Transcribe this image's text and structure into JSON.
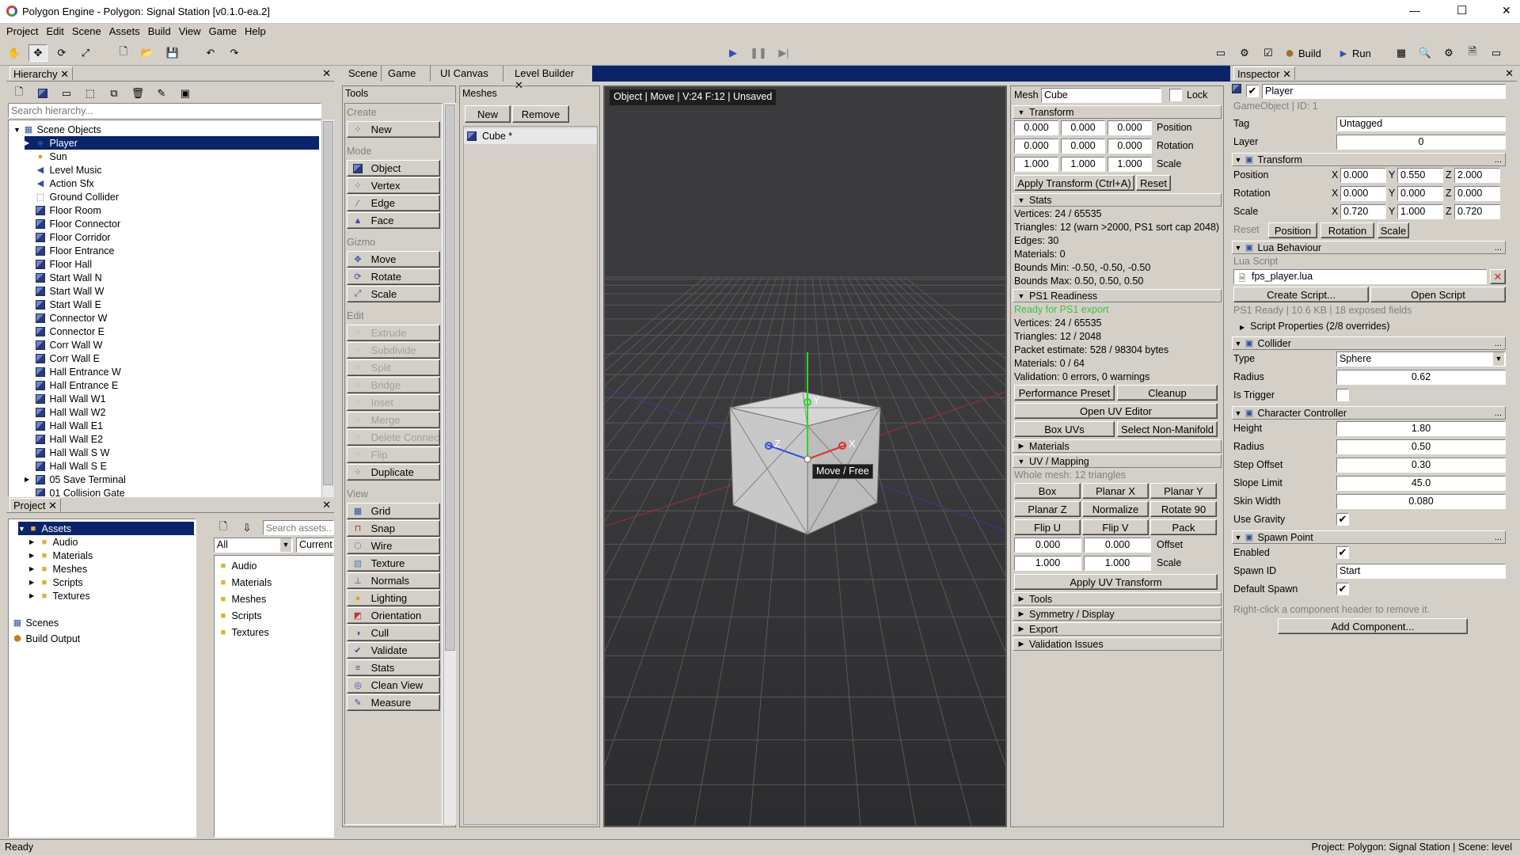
{
  "window": {
    "title": "Polygon Engine - Polygon: Signal Station [v0.1.0-ea.2]",
    "min": "—",
    "max": "☐",
    "close": "✕"
  },
  "menu": [
    "Project",
    "Edit",
    "Scene",
    "Assets",
    "Build",
    "View",
    "Game",
    "Help"
  ],
  "toolbar": {
    "build_label": "Build",
    "run_label": "Run"
  },
  "hierarchy": {
    "tab": "Hierarchy",
    "search_placeholder": "Search hierarchy...",
    "root": "Scene Objects",
    "items": [
      {
        "label": "Player",
        "icon": "player-icon",
        "selected": true
      },
      {
        "label": "Sun",
        "icon": "bulb-icon"
      },
      {
        "label": "Level Music",
        "icon": "speaker-icon"
      },
      {
        "label": "Action Sfx",
        "icon": "speaker-icon"
      },
      {
        "label": "Ground Collider",
        "icon": "collider-icon"
      },
      {
        "label": "Floor Room",
        "icon": "cube-icon"
      },
      {
        "label": "Floor Connector",
        "icon": "cube-icon"
      },
      {
        "label": "Floor Corridor",
        "icon": "cube-icon"
      },
      {
        "label": "Floor Entrance",
        "icon": "cube-icon"
      },
      {
        "label": "Floor Hall",
        "icon": "cube-icon"
      },
      {
        "label": "Start Wall N",
        "icon": "cube-icon"
      },
      {
        "label": "Start Wall W",
        "icon": "cube-icon"
      },
      {
        "label": "Start Wall E",
        "icon": "cube-icon"
      },
      {
        "label": "Connector W",
        "icon": "cube-icon"
      },
      {
        "label": "Connector E",
        "icon": "cube-icon"
      },
      {
        "label": "Corr Wall W",
        "icon": "cube-icon"
      },
      {
        "label": "Corr Wall E",
        "icon": "cube-icon"
      },
      {
        "label": "Hall Entrance W",
        "icon": "cube-icon"
      },
      {
        "label": "Hall Entrance E",
        "icon": "cube-icon"
      },
      {
        "label": "Hall Wall W1",
        "icon": "cube-icon"
      },
      {
        "label": "Hall Wall W2",
        "icon": "cube-icon"
      },
      {
        "label": "Hall Wall E1",
        "icon": "cube-icon"
      },
      {
        "label": "Hall Wall E2",
        "icon": "cube-icon"
      },
      {
        "label": "Hall Wall S W",
        "icon": "cube-icon"
      },
      {
        "label": "Hall Wall S E",
        "icon": "cube-icon"
      },
      {
        "label": "05 Save Terminal",
        "icon": "cube-icon",
        "expander": true
      },
      {
        "label": "01 Collision Gate",
        "icon": "cube-icon"
      }
    ]
  },
  "project": {
    "tab": "Project",
    "search_placeholder": "Search assets...",
    "filter": "All",
    "scope": "Current",
    "tree": {
      "assets": "Assets",
      "children": [
        "Audio",
        "Materials",
        "Meshes",
        "Scripts",
        "Textures"
      ],
      "scenes": "Scenes",
      "build_output": "Build Output"
    },
    "folders": [
      "Audio",
      "Materials",
      "Meshes",
      "Scripts",
      "Textures"
    ]
  },
  "tabs": [
    "Scene",
    "Game",
    "UI Canvas",
    "Level Builder"
  ],
  "tools": {
    "title": "Tools",
    "create_header": "Create",
    "new": "New",
    "mode_header": "Mode",
    "modes": [
      "Object",
      "Vertex",
      "Edge",
      "Face"
    ],
    "gizmo_header": "Gizmo",
    "gizmos": [
      "Move",
      "Rotate",
      "Scale"
    ],
    "edit_header": "Edit",
    "edits": [
      "Extrude",
      "Subdivide",
      "Split",
      "Bridge",
      "Inset",
      "Merge",
      "Delete Connected",
      "Flip",
      "Duplicate"
    ],
    "view_header": "View",
    "views": [
      "Grid",
      "Snap",
      "Wire",
      "Texture",
      "Normals",
      "Lighting",
      "Orientation",
      "Cull",
      "Validate",
      "Stats",
      "Clean View",
      "Measure"
    ]
  },
  "meshes": {
    "title": "Meshes",
    "new": "New",
    "remove": "Remove",
    "items": [
      "Cube *"
    ]
  },
  "viewport": {
    "status": "Object | Move | V:24 F:12 | Unsaved",
    "tooltip": "Move / Free",
    "axis_x": "X",
    "axis_y": "Y",
    "axis_z": "Z"
  },
  "meshpanel": {
    "mesh_label": "Mesh",
    "mesh_name": "Cube",
    "lock": "Lock",
    "transform_header": "Transform",
    "position": [
      "0.000",
      "0.000",
      "0.000"
    ],
    "rotation": [
      "0.000",
      "0.000",
      "0.000"
    ],
    "scale": [
      "1.000",
      "1.000",
      "1.000"
    ],
    "position_label": "Position",
    "rotation_label": "Rotation",
    "scale_label": "Scale",
    "apply_transform": "Apply Transform (Ctrl+A)",
    "reset": "Reset",
    "stats_header": "Stats",
    "stats": [
      "Vertices: 24 / 65535",
      "Triangles: 12 (warn >2000, PS1 sort cap 2048)",
      "Edges: 30",
      "Materials: 0",
      "Bounds Min: -0.50, -0.50, -0.50",
      "Bounds Max: 0.50, 0.50, 0.50"
    ],
    "ps1_header": "PS1 Readiness",
    "ps1_ready": "Ready for PS1 export",
    "ps1": [
      "Vertices: 24 / 65535",
      "Triangles: 12 / 2048",
      "Packet estimate: 528 / 98304 bytes",
      "Materials: 0 / 64",
      "Validation: 0 errors, 0 warnings"
    ],
    "performance_preset": "Performance Preset",
    "cleanup": "Cleanup",
    "open_uv_editor": "Open UV Editor",
    "box_uvs": "Box UVs",
    "select_non_manifold": "Select Non-Manifold",
    "materials_header": "Materials",
    "uv_header": "UV / Mapping",
    "uv_info": "Whole mesh: 12 triangles",
    "uv_buttons": [
      "Box",
      "Planar X",
      "Planar Y",
      "Planar Z",
      "Normalize",
      "Rotate 90",
      "Flip U",
      "Flip V",
      "Pack"
    ],
    "uv_offset": [
      "0.000",
      "0.000"
    ],
    "uv_scale": [
      "1.000",
      "1.000"
    ],
    "offset_label": "Offset",
    "scale_label2": "Scale",
    "apply_uv": "Apply UV Transform",
    "collapsed": [
      "Tools",
      "Symmetry / Display",
      "Export",
      "Validation Issues"
    ]
  },
  "inspector": {
    "tab": "Inspector",
    "name": "Player",
    "meta": "GameObject  |  ID: 1",
    "tag_label": "Tag",
    "tag": "Untagged",
    "layer_label": "Layer",
    "layer": "0",
    "transform_header": "Transform",
    "position_label": "Position",
    "rotation_label": "Rotation",
    "scale_label": "Scale",
    "position": [
      "0.000",
      "0.550",
      "2.000"
    ],
    "rotation": [
      "0.000",
      "0.000",
      "0.000"
    ],
    "scale": [
      "0.720",
      "1.000",
      "0.720"
    ],
    "axes": [
      "X",
      "Y",
      "Z"
    ],
    "reset_label": "Reset",
    "reset_buttons": [
      "Position",
      "Rotation",
      "Scale"
    ],
    "lua_header": "Lua Behaviour",
    "lua_script_label": "Lua Script",
    "lua_file": "fps_player.lua",
    "create_script": "Create Script...",
    "open_script": "Open Script",
    "lua_info": "PS1 Ready  |  10.6 KB  |  18 exposed fields",
    "script_props": "Script Properties (2/8 overrides)",
    "collider_header": "Collider",
    "type_label": "Type",
    "type": "Sphere",
    "radius_label": "Radius",
    "radius": "0.62",
    "trigger_label": "Is Trigger",
    "cc_header": "Character Controller",
    "cc": [
      {
        "label": "Height",
        "value": "1.80"
      },
      {
        "label": "Radius",
        "value": "0.50"
      },
      {
        "label": "Step Offset",
        "value": "0.30"
      },
      {
        "label": "Slope Limit",
        "value": "45.0"
      },
      {
        "label": "Skin Width",
        "value": "0.080"
      }
    ],
    "gravity_label": "Use Gravity",
    "spawn_header": "Spawn Point",
    "enabled_label": "Enabled",
    "spawn_id_label": "Spawn ID",
    "spawn_id": "Start",
    "default_spawn_label": "Default Spawn",
    "hint": "Right-click a component header to remove it.",
    "add_component": "Add Component..."
  },
  "status": {
    "left": "Ready",
    "right": "Project: Polygon: Signal Station  |  Scene: level"
  }
}
